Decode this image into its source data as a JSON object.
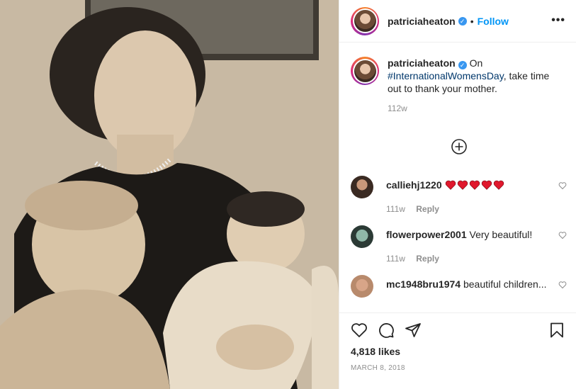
{
  "post": {
    "username": "patriciaheaton",
    "verified_mark": "✓",
    "separator": "•",
    "follow_label": "Follow",
    "more_label": "•••",
    "caption_prefix": "On",
    "caption_hashtag": "#InternationalWomensDay",
    "caption_suffix": ", take time out to thank your mother.",
    "caption_age": "112w",
    "likes": "4,818 likes",
    "date": "MARCH 8, 2018"
  },
  "comments": [
    {
      "username": "calliehj1220",
      "text": "",
      "emoji_hearts": 5,
      "age": "111w",
      "reply": "Reply"
    },
    {
      "username": "flowerpower2001",
      "text": "Very beautiful!",
      "age": "111w",
      "reply": "Reply"
    },
    {
      "username": "mc1948bru1974",
      "text": "beautiful children...",
      "age": "",
      "reply": ""
    }
  ],
  "icons": {
    "like": "heart-icon",
    "comment": "comment-icon",
    "share": "share-icon",
    "save": "bookmark-icon",
    "load_more": "plus-circle-icon"
  },
  "colors": {
    "link": "#0095f6",
    "hashtag": "#00376b",
    "muted": "#8e8e8e",
    "verified": "#3897f0",
    "emoji_heart": "#e0182d"
  }
}
